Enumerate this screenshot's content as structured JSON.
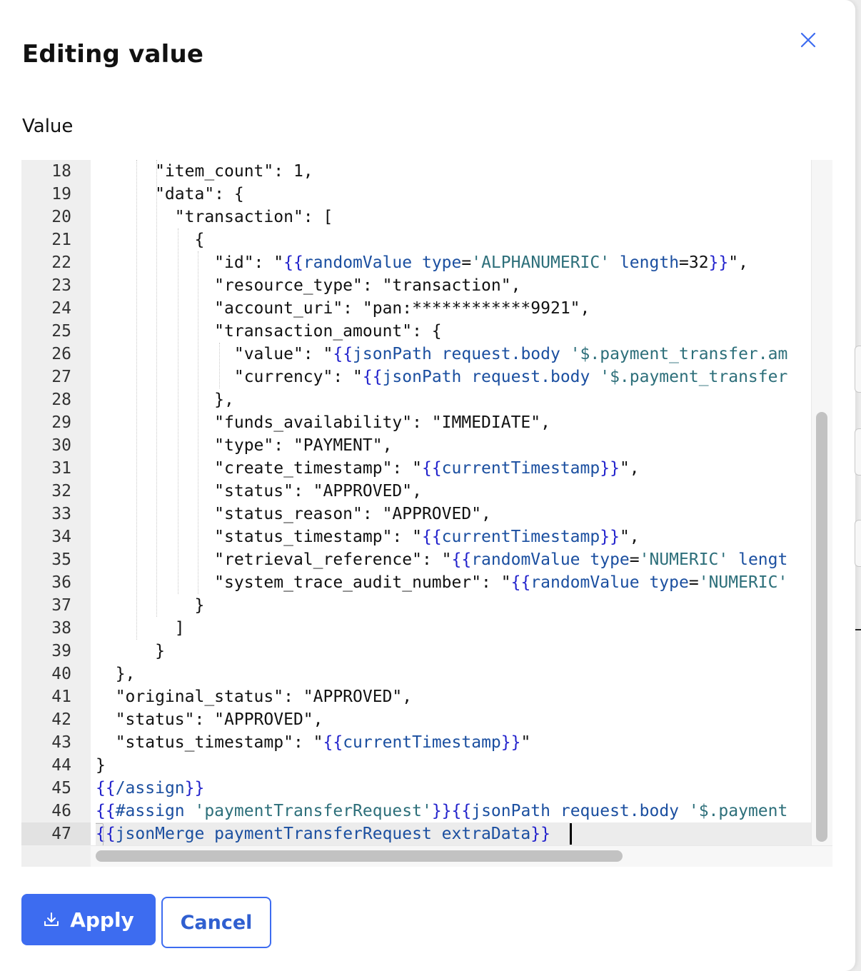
{
  "dialog": {
    "title": "Editing value",
    "field_label": "Value",
    "close_icon": "close-icon"
  },
  "editor": {
    "active_line": 47,
    "lines": [
      {
        "n": "18",
        "tokens": [
          [
            "p",
            "      \"item_count\": 1,"
          ]
        ]
      },
      {
        "n": "19",
        "tokens": [
          [
            "p",
            "      \"data\": {"
          ]
        ]
      },
      {
        "n": "20",
        "tokens": [
          [
            "p",
            "        \"transaction\": ["
          ]
        ]
      },
      {
        "n": "21",
        "tokens": [
          [
            "p",
            "          {"
          ]
        ]
      },
      {
        "n": "22",
        "tokens": [
          [
            "p",
            "            \"id\": \""
          ],
          [
            "b",
            "{{"
          ],
          [
            "h",
            "randomValue type"
          ],
          [
            "p",
            "="
          ],
          [
            "s",
            "'ALPHANUMERIC'"
          ],
          [
            "h",
            " length"
          ],
          [
            "p",
            "=32"
          ],
          [
            "b",
            "}}"
          ],
          [
            "p",
            "\","
          ]
        ]
      },
      {
        "n": "23",
        "tokens": [
          [
            "p",
            "            \"resource_type\": \"transaction\","
          ]
        ]
      },
      {
        "n": "24",
        "tokens": [
          [
            "p",
            "            \"account_uri\": \"pan:************9921\","
          ]
        ]
      },
      {
        "n": "25",
        "tokens": [
          [
            "p",
            "            \"transaction_amount\": {"
          ]
        ]
      },
      {
        "n": "26",
        "tokens": [
          [
            "p",
            "              \"value\": \""
          ],
          [
            "b",
            "{{"
          ],
          [
            "h",
            "jsonPath request.body "
          ],
          [
            "s",
            "'$.payment_transfer.am"
          ]
        ]
      },
      {
        "n": "27",
        "tokens": [
          [
            "p",
            "              \"currency\": \""
          ],
          [
            "b",
            "{{"
          ],
          [
            "h",
            "jsonPath request.body "
          ],
          [
            "s",
            "'$.payment_transfer"
          ]
        ]
      },
      {
        "n": "28",
        "tokens": [
          [
            "p",
            "            },"
          ]
        ]
      },
      {
        "n": "29",
        "tokens": [
          [
            "p",
            "            \"funds_availability\": \"IMMEDIATE\","
          ]
        ]
      },
      {
        "n": "30",
        "tokens": [
          [
            "p",
            "            \"type\": \"PAYMENT\","
          ]
        ]
      },
      {
        "n": "31",
        "tokens": [
          [
            "p",
            "            \"create_timestamp\": \""
          ],
          [
            "b",
            "{{"
          ],
          [
            "h",
            "currentTimestamp"
          ],
          [
            "b",
            "}}"
          ],
          [
            "p",
            "\","
          ]
        ]
      },
      {
        "n": "32",
        "tokens": [
          [
            "p",
            "            \"status\": \"APPROVED\","
          ]
        ]
      },
      {
        "n": "33",
        "tokens": [
          [
            "p",
            "            \"status_reason\": \"APPROVED\","
          ]
        ]
      },
      {
        "n": "34",
        "tokens": [
          [
            "p",
            "            \"status_timestamp\": \""
          ],
          [
            "b",
            "{{"
          ],
          [
            "h",
            "currentTimestamp"
          ],
          [
            "b",
            "}}"
          ],
          [
            "p",
            "\","
          ]
        ]
      },
      {
        "n": "35",
        "tokens": [
          [
            "p",
            "            \"retrieval_reference\": \""
          ],
          [
            "b",
            "{{"
          ],
          [
            "h",
            "randomValue type"
          ],
          [
            "p",
            "="
          ],
          [
            "s",
            "'NUMERIC'"
          ],
          [
            "h",
            " lengt"
          ]
        ]
      },
      {
        "n": "36",
        "tokens": [
          [
            "p",
            "            \"system_trace_audit_number\": \""
          ],
          [
            "b",
            "{{"
          ],
          [
            "h",
            "randomValue type"
          ],
          [
            "p",
            "="
          ],
          [
            "s",
            "'NUMERIC'"
          ]
        ]
      },
      {
        "n": "37",
        "tokens": [
          [
            "p",
            "          }"
          ]
        ]
      },
      {
        "n": "38",
        "tokens": [
          [
            "p",
            "        ]"
          ]
        ]
      },
      {
        "n": "39",
        "tokens": [
          [
            "p",
            "      }"
          ]
        ]
      },
      {
        "n": "40",
        "tokens": [
          [
            "p",
            "  },"
          ]
        ]
      },
      {
        "n": "41",
        "tokens": [
          [
            "p",
            "  \"original_status\": \"APPROVED\","
          ]
        ]
      },
      {
        "n": "42",
        "tokens": [
          [
            "p",
            "  \"status\": \"APPROVED\","
          ]
        ]
      },
      {
        "n": "43",
        "tokens": [
          [
            "p",
            "  \"status_timestamp\": \""
          ],
          [
            "b",
            "{{"
          ],
          [
            "h",
            "currentTimestamp"
          ],
          [
            "b",
            "}}"
          ],
          [
            "p",
            "\""
          ]
        ]
      },
      {
        "n": "44",
        "tokens": [
          [
            "p",
            "}"
          ]
        ]
      },
      {
        "n": "45",
        "tokens": [
          [
            "b",
            "{{"
          ],
          [
            "h",
            "/assign"
          ],
          [
            "b",
            "}}"
          ]
        ]
      },
      {
        "n": "46",
        "tokens": [
          [
            "b",
            "{{"
          ],
          [
            "h",
            "#assign "
          ],
          [
            "s",
            "'paymentTransferRequest'"
          ],
          [
            "b",
            "}}{{"
          ],
          [
            "h",
            "jsonPath request.body "
          ],
          [
            "s",
            "'$.payment"
          ]
        ]
      },
      {
        "n": "47",
        "tokens": [
          [
            "b",
            "{{"
          ],
          [
            "h",
            "jsonMerge paymentTransferRequest extraData"
          ],
          [
            "b",
            "}}"
          ]
        ]
      }
    ]
  },
  "actions": {
    "apply_label": "Apply",
    "apply_icon": "download-icon",
    "cancel_label": "Cancel"
  },
  "colors": {
    "primary": "#3d6cf0",
    "handlebars_brace": "#2222cc",
    "handlebars_expr": "#1b4fa0",
    "string_literal": "#2d6f7a"
  }
}
